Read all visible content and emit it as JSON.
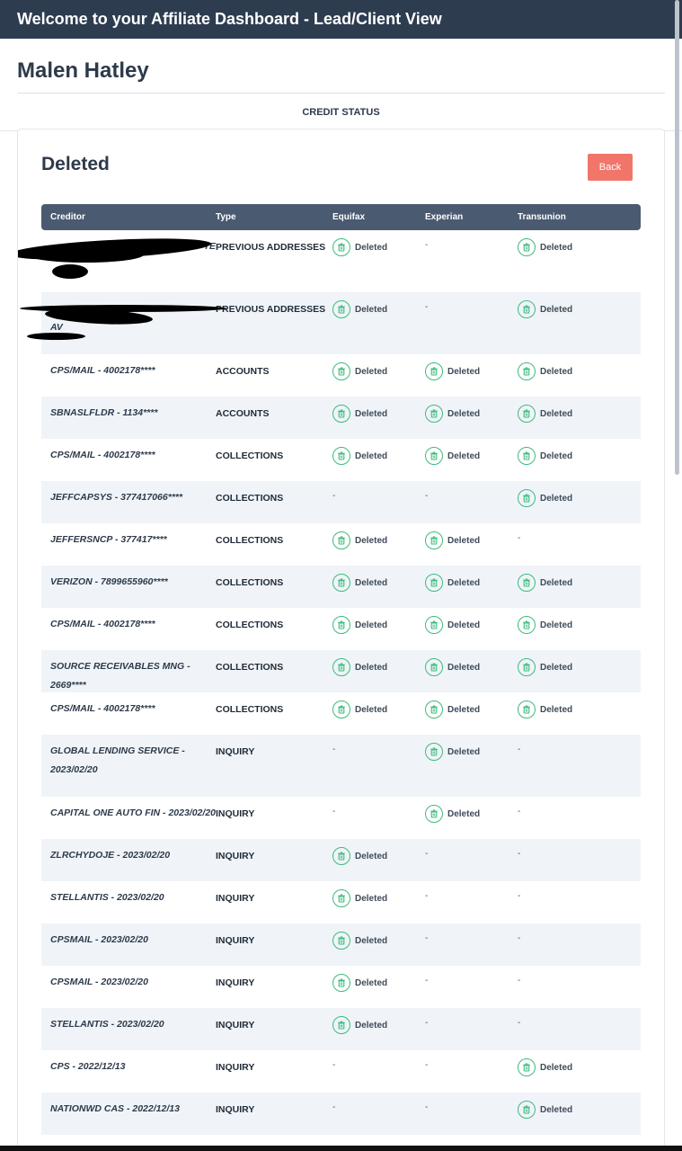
{
  "header": {
    "title": "Welcome to your Affiliate Dashboard - Lead/Client View"
  },
  "client": {
    "name": "Malen Hatley"
  },
  "tab": {
    "label": "CREDIT STATUS"
  },
  "section": {
    "title": "Deleted",
    "back_label": "Back"
  },
  "table": {
    "columns": [
      "Creditor",
      "Type",
      "Equifax",
      "Experian",
      "Transunion"
    ],
    "status_label": "Deleted",
    "rows": [
      {
        "creditor": "TE",
        "type": "PREVIOUS ADDRESSES",
        "equifax": "Deleted",
        "experian": "-",
        "transunion": "Deleted"
      },
      {
        "creditor": "AV",
        "type": "PREVIOUS ADDRESSES",
        "equifax": "Deleted",
        "experian": "-",
        "transunion": "Deleted"
      },
      {
        "creditor": "CPS/MAIL - 4002178****",
        "type": "ACCOUNTS",
        "equifax": "Deleted",
        "experian": "Deleted",
        "transunion": "Deleted"
      },
      {
        "creditor": "SBNASLFLDR - 1134****",
        "type": "ACCOUNTS",
        "equifax": "Deleted",
        "experian": "Deleted",
        "transunion": "Deleted"
      },
      {
        "creditor": "CPS/MAIL - 4002178****",
        "type": "COLLECTIONS",
        "equifax": "Deleted",
        "experian": "Deleted",
        "transunion": "Deleted"
      },
      {
        "creditor": "JEFFCAPSYS - 377417066****",
        "type": "COLLECTIONS",
        "equifax": "-",
        "experian": "-",
        "transunion": "Deleted"
      },
      {
        "creditor": "JEFFERSNCP - 377417****",
        "type": "COLLECTIONS",
        "equifax": "Deleted",
        "experian": "Deleted",
        "transunion": "-"
      },
      {
        "creditor": "VERIZON - 7899655960****",
        "type": "COLLECTIONS",
        "equifax": "Deleted",
        "experian": "Deleted",
        "transunion": "Deleted"
      },
      {
        "creditor": "CPS/MAIL - 4002178****",
        "type": "COLLECTIONS",
        "equifax": "Deleted",
        "experian": "Deleted",
        "transunion": "Deleted"
      },
      {
        "creditor": "SOURCE RECEIVABLES MNG - 2669****",
        "type": "COLLECTIONS",
        "equifax": "Deleted",
        "experian": "Deleted",
        "transunion": "Deleted"
      },
      {
        "creditor": "CPS/MAIL - 4002178****",
        "type": "COLLECTIONS",
        "equifax": "Deleted",
        "experian": "Deleted",
        "transunion": "Deleted"
      },
      {
        "creditor": "GLOBAL LENDING SERVICE - 2023/02/20",
        "type": "INQUIRY",
        "equifax": "-",
        "experian": "Deleted",
        "transunion": "-"
      },
      {
        "creditor": "CAPITAL ONE AUTO FIN - 2023/02/20",
        "type": "INQUIRY",
        "equifax": "-",
        "experian": "Deleted",
        "transunion": "-"
      },
      {
        "creditor": "ZLRCHYDOJE - 2023/02/20",
        "type": "INQUIRY",
        "equifax": "Deleted",
        "experian": "-",
        "transunion": "-"
      },
      {
        "creditor": "STELLANTIS - 2023/02/20",
        "type": "INQUIRY",
        "equifax": "Deleted",
        "experian": "-",
        "transunion": "-"
      },
      {
        "creditor": "CPSMAIL - 2023/02/20",
        "type": "INQUIRY",
        "equifax": "Deleted",
        "experian": "-",
        "transunion": "-"
      },
      {
        "creditor": "CPSMAIL - 2023/02/20",
        "type": "INQUIRY",
        "equifax": "Deleted",
        "experian": "-",
        "transunion": "-"
      },
      {
        "creditor": "STELLANTIS - 2023/02/20",
        "type": "INQUIRY",
        "equifax": "Deleted",
        "experian": "-",
        "transunion": "-"
      },
      {
        "creditor": "CPS - 2022/12/13",
        "type": "INQUIRY",
        "equifax": "-",
        "experian": "-",
        "transunion": "Deleted"
      },
      {
        "creditor": "NATIONWD CAS - 2022/12/13",
        "type": "INQUIRY",
        "equifax": "-",
        "experian": "-",
        "transunion": "Deleted"
      }
    ]
  },
  "colors": {
    "header_bg": "#2e3c50",
    "table_head_bg": "#4a5a70",
    "back_btn": "#f2756a",
    "deleted_icon": "#3dbb7d",
    "alt_row": "#f0f4f8"
  }
}
